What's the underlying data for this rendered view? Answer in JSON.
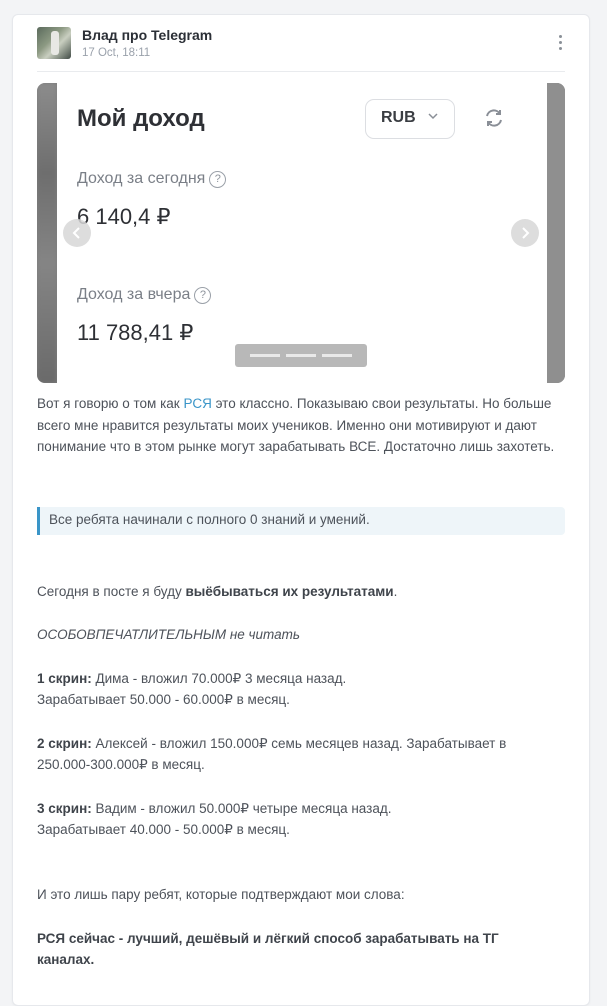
{
  "post": {
    "channel_name": "Влад про Telegram",
    "time": "17 Oct, 18:11"
  },
  "slide": {
    "title": "Мой доход",
    "currency": "RUB",
    "today_label": "Доход за сегодня",
    "today_value": "6 140,4 ₽",
    "yesterday_label": "Доход за вчера",
    "yesterday_value": "11 788,41 ₽",
    "help_glyph": "?"
  },
  "carousel": {
    "page_count": 3
  },
  "text": {
    "p1_before": "Вот я говорю о том как ",
    "p1_link": "РСЯ",
    "p1_after": " это классно. Показываю свои результаты. Но больше всего мне нравится результаты моих учеников. Именно они мотивируют и дают понимание что в этом рынке могут зарабатывать ВСЕ. Достаточно лишь захотеть.",
    "quote": "Все ребята начинали с полного 0 знаний и умений.",
    "today_before": "Сегодня в посте я буду ",
    "today_bold": "выёбываться их результатами",
    "today_after": ".",
    "warning": "ОСОБОВПЕЧАТЛИТЕЛЬНЫМ не читать",
    "s1_label": "1 скрин:",
    "s1_line1": " Дима - вложил 70.000₽ 3 месяца назад.",
    "s1_line2": "Зарабатывает 50.000 - 60.000₽ в месяц.",
    "s2_label": "2 скрин:",
    "s2_line1": " Алексей - вложил 150.000₽ семь месяцев назад. Зарабатывает в",
    "s2_line2": "250.000-300.000₽ в месяц.",
    "s3_label": "3 скрин:",
    "s3_line1": " Вадим - вложил 50.000₽ четыре месяца назад.",
    "s3_line2": "Зарабатывает 40.000 - 50.000₽ в месяц.",
    "closing": "И это лишь пару ребят, которые подтверждают мои слова:",
    "final_line1": "РСЯ сейчас - лучший, дешёвый и лёгкий способ зарабатывать на ТГ",
    "final_line2": "каналах."
  },
  "colors": {
    "link": "#3a95c8",
    "quote_bg": "#eef5f9"
  },
  "icons": [
    "kebab-menu-icon",
    "chevron-down-icon",
    "refresh-icon",
    "help-circle-icon",
    "chevron-left-icon",
    "chevron-right-icon"
  ]
}
